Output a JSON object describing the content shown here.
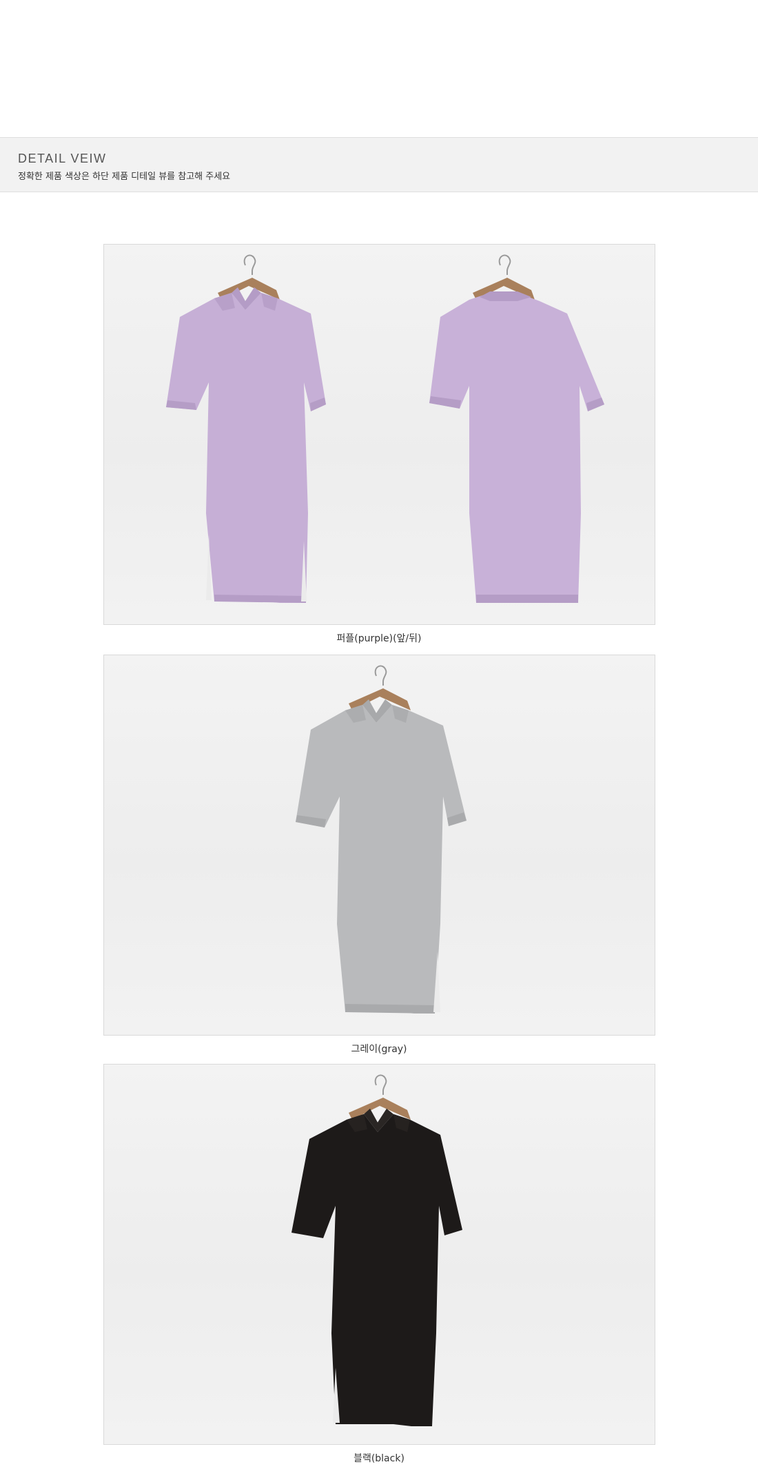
{
  "detail_banner": {
    "title": "DETAIL VEIW",
    "subtitle": "정확한 제품 색상은 하단 제품 디테일 뷰를 참고해 주세요"
  },
  "photos": [
    {
      "caption": "퍼플(purple)(앞/뒤)",
      "dress_color": "#c6afd6",
      "views": [
        "front",
        "back"
      ]
    },
    {
      "caption": "그레이(gray)",
      "dress_color": "#b9babc",
      "views": [
        "front"
      ]
    },
    {
      "caption": "블랙(black)",
      "dress_color": "#1d1a19",
      "views": [
        "front"
      ]
    }
  ]
}
